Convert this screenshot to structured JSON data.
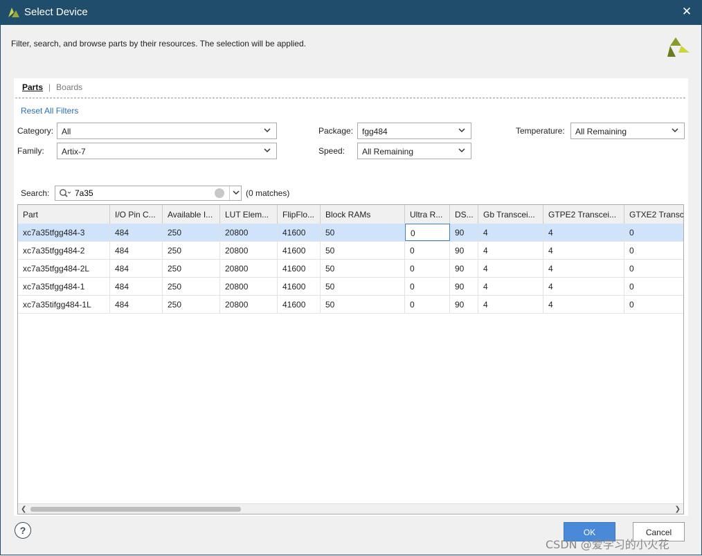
{
  "window": {
    "title": "Select Device",
    "close_glyph": "✕"
  },
  "description": "Filter, search, and browse parts by their resources. The selection will be applied.",
  "tabs": [
    {
      "label": "Parts",
      "active": true
    },
    {
      "label": "Boards",
      "active": false
    }
  ],
  "tab_separator": "|",
  "reset_filters": "Reset All Filters",
  "filters": {
    "category": {
      "label": "Category:",
      "value": "All"
    },
    "family": {
      "label": "Family:",
      "value": "Artix-7"
    },
    "package": {
      "label": "Package:",
      "value": "fgg484"
    },
    "speed": {
      "label": "Speed:",
      "value": "All Remaining"
    },
    "temperature": {
      "label": "Temperature:",
      "value": "All Remaining"
    }
  },
  "search": {
    "label": "Search:",
    "value": "7a35",
    "matches": "(0 matches)"
  },
  "table": {
    "columns": [
      "Part",
      "I/O Pin C...",
      "Available I...",
      "LUT Elem...",
      "FlipFlo...",
      "Block RAMs",
      "Ultra R...",
      "DS...",
      "Gb Transcei...",
      "GTPE2 Transcei...",
      "GTXE2 Transc"
    ],
    "rows": [
      [
        "xc7a35tfgg484-3",
        "484",
        "250",
        "20800",
        "41600",
        "50",
        "0",
        "90",
        "4",
        "4",
        "0"
      ],
      [
        "xc7a35tfgg484-2",
        "484",
        "250",
        "20800",
        "41600",
        "50",
        "0",
        "90",
        "4",
        "4",
        "0"
      ],
      [
        "xc7a35tfgg484-2L",
        "484",
        "250",
        "20800",
        "41600",
        "50",
        "0",
        "90",
        "4",
        "4",
        "0"
      ],
      [
        "xc7a35tfgg484-1",
        "484",
        "250",
        "20800",
        "41600",
        "50",
        "0",
        "90",
        "4",
        "4",
        "0"
      ],
      [
        "xc7a35tifgg484-1L",
        "484",
        "250",
        "20800",
        "41600",
        "50",
        "0",
        "90",
        "4",
        "4",
        "0"
      ]
    ],
    "selected_row": 0
  },
  "buttons": {
    "help": "?",
    "ok": "OK",
    "cancel": "Cancel"
  },
  "watermark": "CSDN @爱学习的小火花",
  "colors": {
    "titlebar": "#1f4d6b",
    "accent": "#4a88d8",
    "selection": "#cfe3fb",
    "link": "#2a6ebb"
  },
  "icons": [
    "vivado-logo-icon",
    "close-icon",
    "xilinx-brand-icon",
    "chevron-down-icon",
    "search-icon",
    "clear-icon",
    "help-icon",
    "scroll-left-icon",
    "scroll-right-icon"
  ]
}
